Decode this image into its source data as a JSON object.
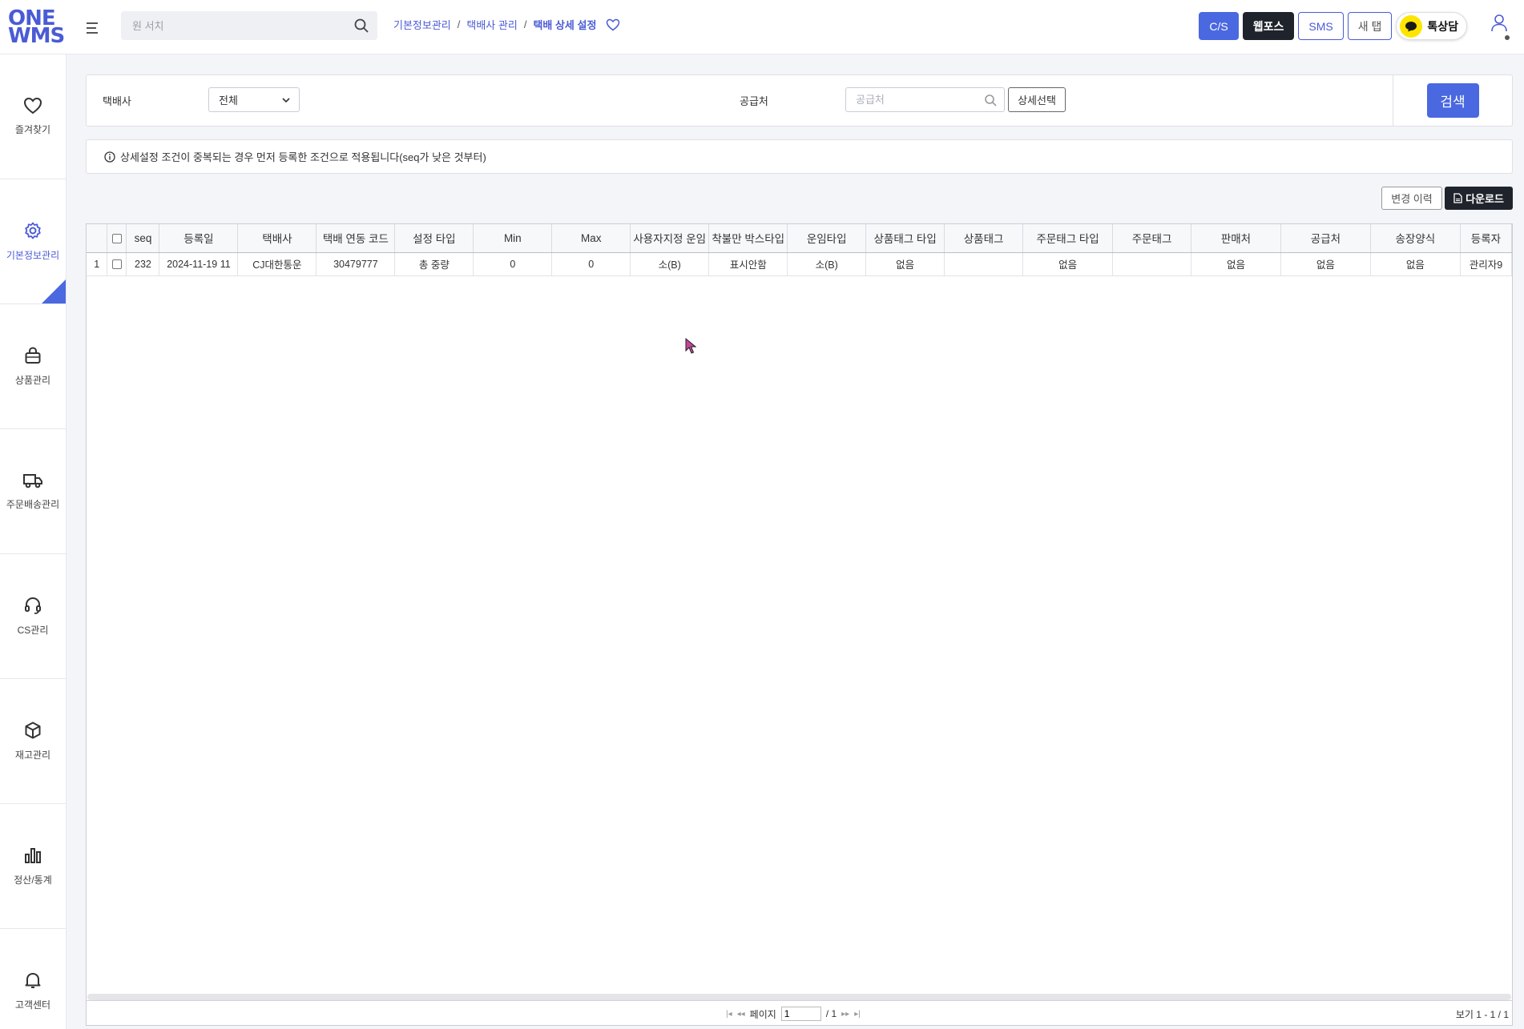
{
  "app": {
    "logo_line1": "ONE",
    "logo_line2": "WMS"
  },
  "search": {
    "placeholder": "원 서치"
  },
  "breadcrumb": {
    "items": [
      "기본정보관리",
      "택배사 관리",
      "택배 상세 설정"
    ],
    "separator": "/"
  },
  "top_actions": {
    "cs": "C/S",
    "webforce": "웹포스",
    "sms": "SMS",
    "new_tab": "새 탭",
    "talk": "톡상담"
  },
  "sidebar": {
    "items": [
      {
        "label": "즐겨찾기",
        "icon": "heart-icon"
      },
      {
        "label": "기본정보관리",
        "icon": "gear-icon",
        "active": true
      },
      {
        "label": "상품관리",
        "icon": "bag-icon"
      },
      {
        "label": "주문배송관리",
        "icon": "truck-icon"
      },
      {
        "label": "CS관리",
        "icon": "headset-icon"
      },
      {
        "label": "재고관리",
        "icon": "box-icon"
      },
      {
        "label": "정산/통계",
        "icon": "bar-chart-icon"
      },
      {
        "label": "고객센터",
        "icon": "bell-icon"
      }
    ]
  },
  "filter": {
    "carrier_label": "택배사",
    "carrier_value": "전체",
    "supplier_label": "공급처",
    "supplier_placeholder": "공급처",
    "detail_select": "상세선택",
    "search_button": "검색"
  },
  "notice": {
    "text": "상세설정 조건이 중복되는 경우 먼저 등록한 조건으로 적용됩니다(seq가 낮은 것부터)"
  },
  "actions": {
    "history": "변경 이력",
    "download": "다운로드"
  },
  "grid": {
    "columns": [
      "",
      "",
      "seq",
      "등록일",
      "택배사",
      "택배 연동 코드",
      "설정 타입",
      "Min",
      "Max",
      "사용자지정 운임",
      "착불만 박스타입",
      "운임타입",
      "상품태그 타입",
      "상품태그",
      "주문태그 타입",
      "주문태그",
      "판매처",
      "공급처",
      "송장양식",
      "등록자"
    ],
    "rows": [
      [
        "1",
        "",
        "232",
        "2024-11-19 11",
        "CJ대한통운",
        "30479777",
        "총 중량",
        "0",
        "0",
        "소(B)",
        "표시안함",
        "소(B)",
        "없음",
        "",
        "없음",
        "",
        "없음",
        "없음",
        "없음",
        "관리자9"
      ]
    ]
  },
  "pager": {
    "page_label": "페이지",
    "page_value": "1",
    "total": "/ 1",
    "summary": "보기 1 - 1 / 1"
  },
  "colors": {
    "accent": "#4a68e0",
    "dark": "#1f242c",
    "kakao": "#fee500"
  }
}
